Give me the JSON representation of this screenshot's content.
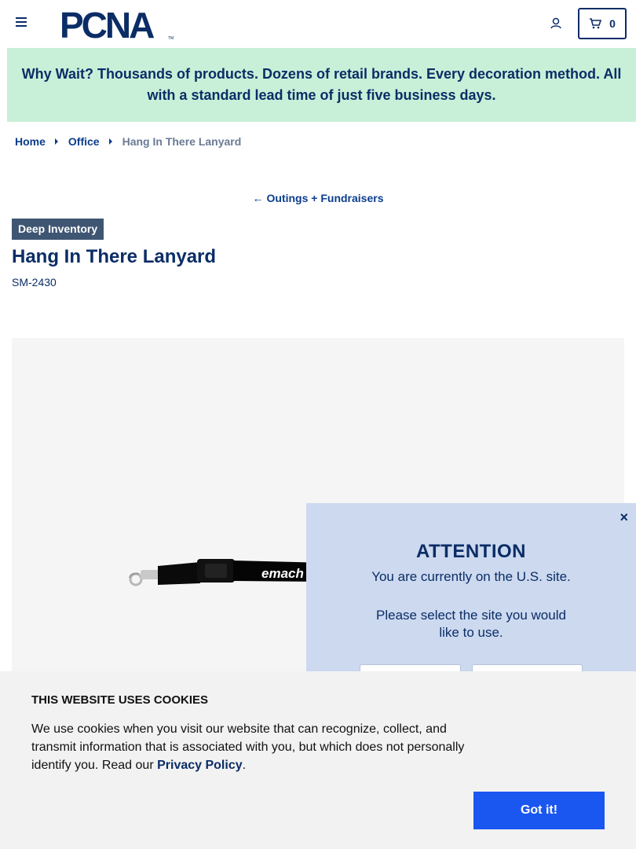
{
  "header": {
    "logo_text": "PCNA",
    "logo_tm": "TM",
    "cart_count": "0"
  },
  "banner": {
    "text": "Why Wait? Thousands of products. Dozens of retail brands. Every decoration method. All with a standard lead time of just five business days."
  },
  "breadcrumb": {
    "items": [
      "Home",
      "Office"
    ],
    "current": "Hang In There Lanyard"
  },
  "back_link": {
    "label": "Outings + Fundraisers"
  },
  "product": {
    "badge": "Deep Inventory",
    "title": "Hang In There Lanyard",
    "sku": "SM-2430",
    "imprint_text": "emach"
  },
  "attention": {
    "close": "×",
    "title": "ATTENTION",
    "line1": "You are currently on the U.S. site.",
    "line2": "Please select the site you would like to use."
  },
  "cookie": {
    "title": "THIS WEBSITE USES COOKIES",
    "text": "We use cookies when you visit our website that can recognize, collect, and transmit information that is associated with you, but which does not personally identify you. Read our ",
    "link": "Privacy Policy",
    "text_end": ".",
    "button": "Got it!"
  },
  "colors": {
    "brand_navy": "#0b2d66",
    "banner_green": "#c8f0d8",
    "modal_blue": "#ccd9ef",
    "button_blue": "#1a56f0"
  }
}
